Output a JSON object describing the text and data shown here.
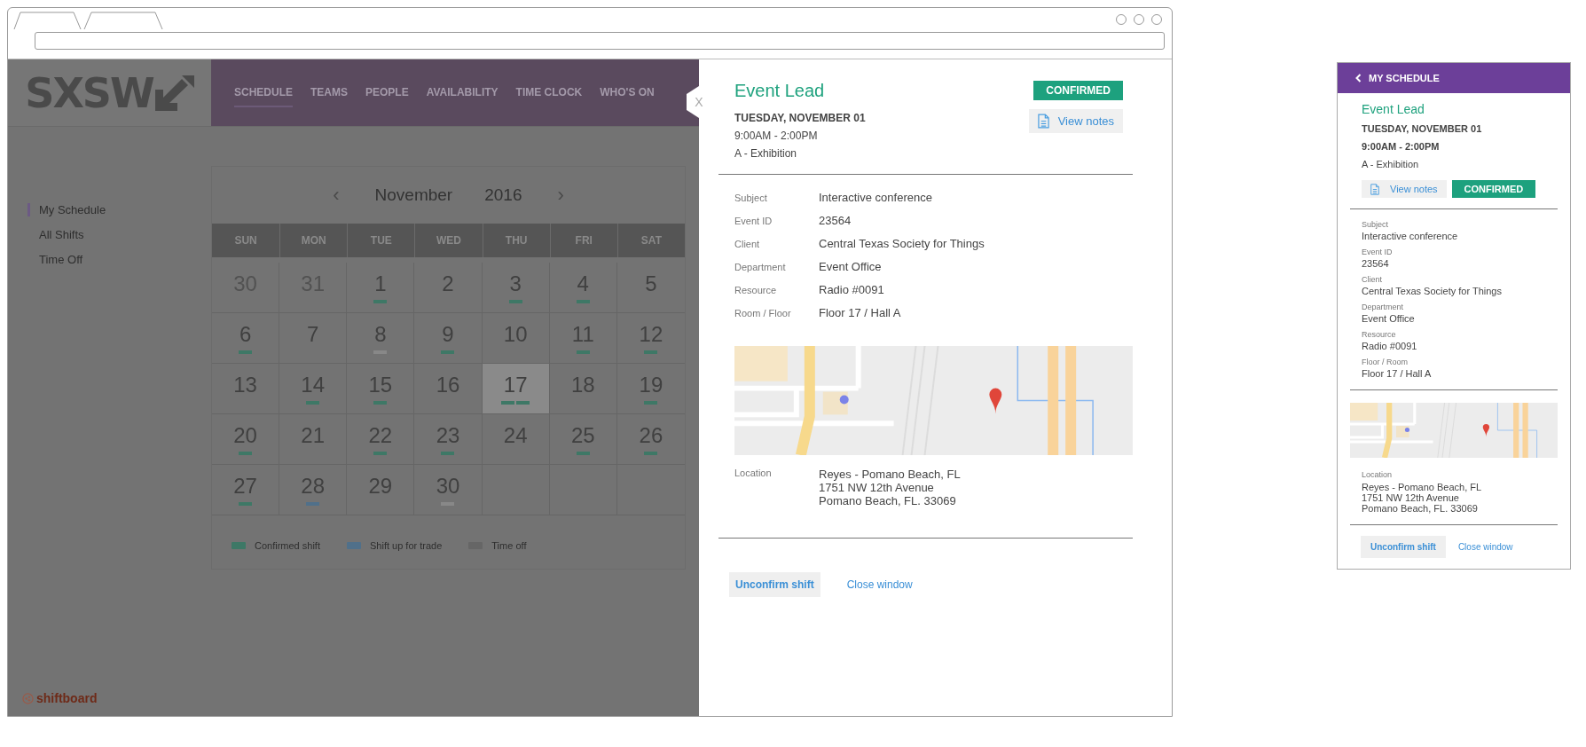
{
  "app": {
    "logo": "SXSW",
    "nav": [
      {
        "label": "SCHEDULE",
        "selected": true
      },
      {
        "label": "TEAMS",
        "selected": false
      },
      {
        "label": "PEOPLE",
        "selected": false
      },
      {
        "label": "AVAILABILITY",
        "selected": false
      },
      {
        "label": "TIME CLOCK",
        "selected": false
      },
      {
        "label": "WHO'S ON",
        "selected": false
      }
    ],
    "sidebar": [
      {
        "label": "My Schedule",
        "selected": true
      },
      {
        "label": "All Shifts",
        "selected": false
      },
      {
        "label": "Time Off",
        "selected": false
      }
    ],
    "calendar": {
      "prev": "‹",
      "month": "November",
      "year": "2016",
      "next": "›",
      "weekdays": [
        "SUN",
        "MON",
        "TUE",
        "WED",
        "THU",
        "FRI",
        "SAT"
      ],
      "days": [
        {
          "day": "30",
          "muted": true,
          "selected": false
        },
        {
          "day": "31",
          "muted": true,
          "selected": false
        },
        {
          "day": "1",
          "muted": false,
          "selected": false,
          "marks": [
            {
              "color": "#3e7866"
            }
          ]
        },
        {
          "day": "2",
          "muted": false,
          "selected": false
        },
        {
          "day": "3",
          "muted": false,
          "selected": false,
          "marks": [
            {
              "color": "#3e7866"
            }
          ]
        },
        {
          "day": "4",
          "muted": false,
          "selected": false,
          "marks": [
            {
              "color": "#3e7866"
            }
          ]
        },
        {
          "day": "5",
          "muted": false,
          "selected": false
        },
        {
          "day": "6",
          "muted": false,
          "selected": false,
          "marks": [
            {
              "color": "#3e7866"
            }
          ]
        },
        {
          "day": "7",
          "muted": false,
          "selected": false
        },
        {
          "day": "8",
          "muted": false,
          "selected": false,
          "marks": [
            {
              "color": "#888888"
            }
          ]
        },
        {
          "day": "9",
          "muted": false,
          "selected": false,
          "marks": [
            {
              "color": "#3e7866"
            }
          ]
        },
        {
          "day": "10",
          "muted": false,
          "selected": false
        },
        {
          "day": "11",
          "muted": false,
          "selected": false,
          "marks": [
            {
              "color": "#3e7866"
            }
          ]
        },
        {
          "day": "12",
          "muted": false,
          "selected": false,
          "marks": [
            {
              "color": "#3e7866"
            }
          ]
        },
        {
          "day": "13",
          "muted": false,
          "selected": false
        },
        {
          "day": "14",
          "muted": false,
          "selected": false,
          "marks": [
            {
              "color": "#3e7866"
            }
          ]
        },
        {
          "day": "15",
          "muted": false,
          "selected": false,
          "marks": [
            {
              "color": "#3e7866"
            }
          ]
        },
        {
          "day": "16",
          "muted": false,
          "selected": false
        },
        {
          "day": "17",
          "muted": false,
          "selected": true,
          "marks": [
            {
              "color": "#3e7866"
            },
            {
              "color": "#3e7866"
            }
          ]
        },
        {
          "day": "18",
          "muted": false,
          "selected": false
        },
        {
          "day": "19",
          "muted": false,
          "selected": false,
          "marks": [
            {
              "color": "#3e7866"
            }
          ]
        },
        {
          "day": "20",
          "muted": false,
          "selected": false,
          "marks": [
            {
              "color": "#3e7866"
            }
          ]
        },
        {
          "day": "21",
          "muted": false,
          "selected": false
        },
        {
          "day": "22",
          "muted": false,
          "selected": false,
          "marks": [
            {
              "color": "#3e7866"
            }
          ]
        },
        {
          "day": "23",
          "muted": false,
          "selected": false,
          "marks": [
            {
              "color": "#3e7866"
            }
          ]
        },
        {
          "day": "24",
          "muted": false,
          "selected": false
        },
        {
          "day": "25",
          "muted": false,
          "selected": false,
          "marks": [
            {
              "color": "#3e7866"
            }
          ]
        },
        {
          "day": "26",
          "muted": false,
          "selected": false,
          "marks": [
            {
              "color": "#3e7866"
            }
          ]
        },
        {
          "day": "27",
          "muted": false,
          "selected": false,
          "marks": [
            {
              "color": "#3e7866"
            }
          ]
        },
        {
          "day": "28",
          "muted": false,
          "selected": false,
          "marks": [
            {
              "color": "#50708a"
            }
          ]
        },
        {
          "day": "29",
          "muted": false,
          "selected": false
        },
        {
          "day": "30",
          "muted": false,
          "selected": false,
          "marks": [
            {
              "color": "#888888"
            }
          ]
        }
      ],
      "legend": [
        {
          "label": "Confirmed shift",
          "color": "#3e7866"
        },
        {
          "label": "Shift up for trade",
          "color": "#50708a"
        },
        {
          "label": "Time off",
          "color": "#666666"
        }
      ]
    },
    "footer_logo": "shiftboard"
  },
  "detail_panel": {
    "close": "X",
    "title": "Event Lead",
    "status": "CONFIRMED",
    "date": "TUESDAY, NOVEMBER 01",
    "time": "9:00AM - 2:00PM",
    "area": "A - Exhibition",
    "view_notes": "View notes",
    "fields": [
      {
        "label": "Subject",
        "value": "Interactive conference"
      },
      {
        "label": "Event ID",
        "value": "23564"
      },
      {
        "label": "Client",
        "value": "Central Texas Society for Things"
      },
      {
        "label": "Department",
        "value": "Event Office"
      },
      {
        "label": "Resource",
        "value": "Radio #0091"
      },
      {
        "label": "Room / Floor",
        "value": "Floor 17 / Hall A"
      }
    ],
    "location": {
      "label": "Location",
      "lines": [
        "Reyes - Pomano Beach, FL",
        "1751 NW 12th  Avenue",
        "Pomano Beach, FL. 33069"
      ]
    },
    "unconfirm": "Unconfirm shift",
    "close_window": "Close window"
  },
  "mobile_panel": {
    "back": "MY SCHEDULE",
    "title": "Event Lead",
    "date": "TUESDAY, NOVEMBER 01",
    "time": "9:00AM - 2:00PM",
    "area": "A - Exhibition",
    "view_notes": "View notes",
    "status": "CONFIRMED",
    "fields": [
      {
        "label": "Subject",
        "value": "Interactive conference"
      },
      {
        "label": "Event ID",
        "value": "23564"
      },
      {
        "label": "Client",
        "value": "Central Texas Society for Things"
      },
      {
        "label": "Department",
        "value": "Event Office"
      },
      {
        "label": "Resource",
        "value": "Radio #0091"
      },
      {
        "label": "Floor / Room",
        "value": "Floor 17 / Hall A"
      }
    ],
    "location": {
      "label": "Location",
      "lines": [
        "Reyes - Pomano Beach, FL",
        "1751 NW 12th  Avenue",
        "Pomano Beach, FL. 33069"
      ]
    },
    "unconfirm": "Unconfirm shift",
    "close_window": "Close window"
  }
}
